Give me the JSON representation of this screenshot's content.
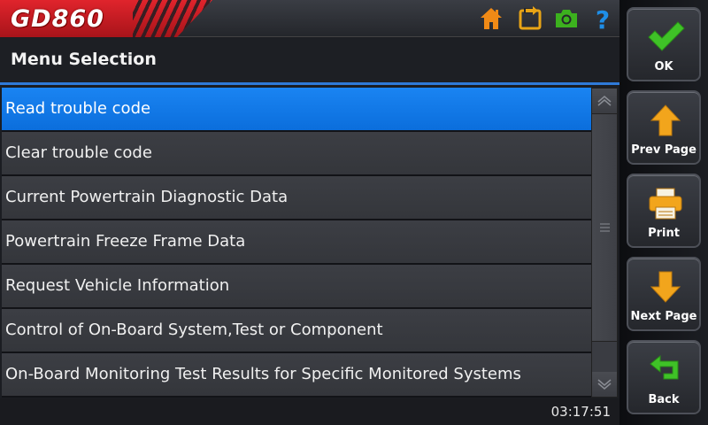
{
  "header": {
    "logo_text": "GD860",
    "icons": [
      "home-icon",
      "exit-icon",
      "camera-icon",
      "help-icon"
    ],
    "colors": {
      "logo": "#d91f26",
      "home": "#f08a16",
      "exit": "#e8a416",
      "camera": "#3cb11e",
      "help": "#1e8ee8"
    }
  },
  "page": {
    "title": "Menu Selection"
  },
  "menu": {
    "items": [
      {
        "label": "Read trouble code",
        "selected": true
      },
      {
        "label": "Clear trouble code",
        "selected": false
      },
      {
        "label": "Current Powertrain Diagnostic Data",
        "selected": false
      },
      {
        "label": "Powertrain Freeze Frame Data",
        "selected": false
      },
      {
        "label": "Request Vehicle Information",
        "selected": false
      },
      {
        "label": "Control of On-Board System,Test or Component",
        "selected": false
      },
      {
        "label": "On-Board Monitoring Test Results for Specific Monitored Systems",
        "selected": false
      }
    ],
    "selection_color": "#1a84f2"
  },
  "status": {
    "time": "03:17:51"
  },
  "sidebar": {
    "buttons": [
      {
        "label": "OK",
        "icon": "checkmark-icon"
      },
      {
        "label": "Prev Page",
        "icon": "arrow-up-icon"
      },
      {
        "label": "Print",
        "icon": "printer-icon"
      },
      {
        "label": "Next Page",
        "icon": "arrow-down-icon"
      },
      {
        "label": "Back",
        "icon": "back-arrow-icon"
      }
    ]
  }
}
